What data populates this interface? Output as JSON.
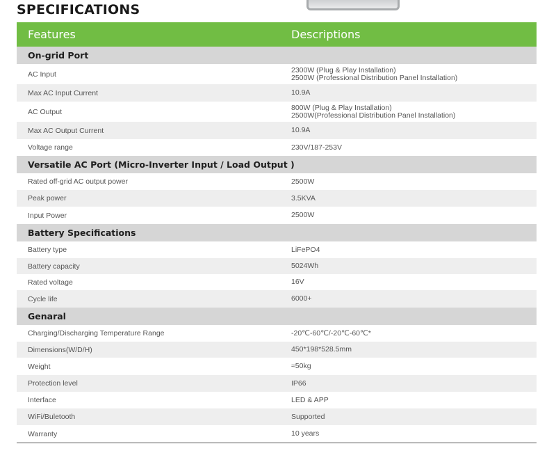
{
  "page": {
    "title": "SPECIFICATIONS"
  },
  "table": {
    "header": {
      "features": "Features",
      "descriptions": "Descriptions"
    },
    "sections": [
      {
        "title": "On-grid Port",
        "rows": [
          {
            "feature": "AC Input",
            "description": [
              "2300W (Plug & Play Installation)",
              "2500W (Professional Distribution Panel Installation)"
            ]
          },
          {
            "feature": "Max AC Input Current",
            "description": [
              "10.9A"
            ]
          },
          {
            "feature": "AC Output",
            "description": [
              "800W (Plug & Play Installation)",
              "2500W(Professional Distribution Panel Installation)"
            ]
          },
          {
            "feature": "Max AC Output Current",
            "description": [
              "10.9A"
            ]
          },
          {
            "feature": "Voltage range",
            "description": [
              "230V/187-253V"
            ]
          }
        ]
      },
      {
        "title": "Versatile AC Port (Micro-Inverter Input / Load Output )",
        "rows": [
          {
            "feature": "Rated off-grid AC output power",
            "description": [
              "2500W"
            ]
          },
          {
            "feature": "Peak power",
            "description": [
              "3.5KVA"
            ]
          },
          {
            "feature": "Input Power",
            "description": [
              "2500W"
            ]
          }
        ]
      },
      {
        "title": "Battery Specifications",
        "rows": [
          {
            "feature": "Battery type",
            "description": [
              "LiFePO4"
            ]
          },
          {
            "feature": "Battery capacity",
            "description": [
              "5024Wh"
            ]
          },
          {
            "feature": "Rated voltage",
            "description": [
              "16V"
            ]
          },
          {
            "feature": "Cycle life",
            "description": [
              "6000+"
            ]
          }
        ]
      },
      {
        "title": "Genaral",
        "rows": [
          {
            "feature": "Charging/Discharging Temperature Range",
            "description": [
              "-20℃-60℃/-20℃-60℃*"
            ]
          },
          {
            "feature": "Dimensions(W/D/H)",
            "description": [
              "450*198*528.5mm"
            ]
          },
          {
            "feature": "Weight",
            "description": [
              "≈50kg"
            ]
          },
          {
            "feature": "Protection level",
            "description": [
              "IP66"
            ]
          },
          {
            "feature": "Interface",
            "description": [
              "LED & APP"
            ]
          },
          {
            "feature": "WiFi/Buletooth",
            "description": [
              "Supported"
            ]
          },
          {
            "feature": "Warranty",
            "description": [
              "10 years"
            ]
          }
        ]
      }
    ]
  }
}
